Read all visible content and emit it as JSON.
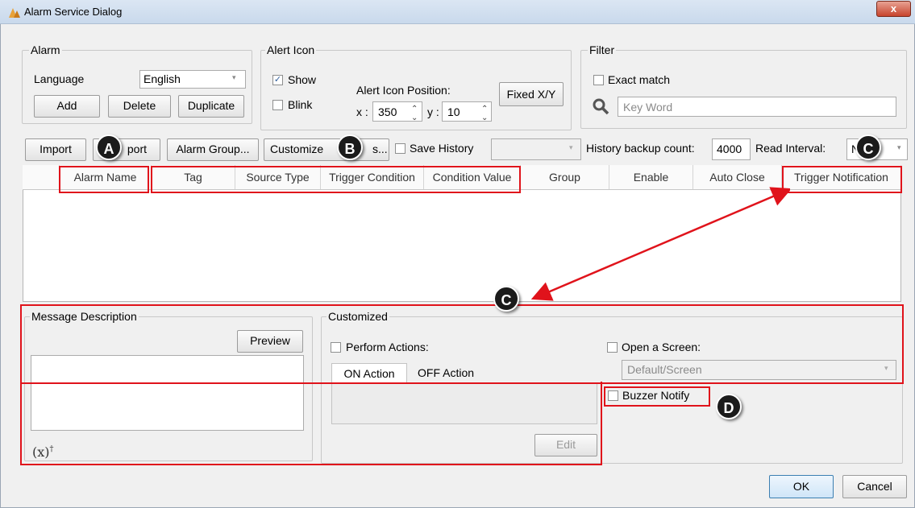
{
  "window": {
    "title": "Alarm Service Dialog",
    "close_symbol": "x"
  },
  "alarm": {
    "legend": "Alarm",
    "language_label": "Language",
    "language_value": "English",
    "add": "Add",
    "delete": "Delete",
    "duplicate": "Duplicate"
  },
  "alert_icon": {
    "legend": "Alert Icon",
    "show": "Show",
    "show_checked": true,
    "blink": "Blink",
    "position_label": "Alert Icon Position:",
    "x_label": "x :",
    "x_value": "350",
    "y_label": "y :",
    "y_value": "10",
    "fixed": "Fixed X/Y"
  },
  "filter": {
    "legend": "Filter",
    "exact_match": "Exact match",
    "keyword_placeholder": "Key Word"
  },
  "toolbar": {
    "import": "Import",
    "export_partial": "port",
    "alarm_group": "Alarm Group...",
    "customize": "Customize",
    "customize_tail": "s...",
    "save_history": "Save History",
    "history_backup_label": "History backup count:",
    "history_backup_value": "4000",
    "read_interval_label": "Read Interval:",
    "read_interval_value": "N"
  },
  "table": {
    "columns": [
      "Alarm Name",
      "Tag",
      "Source Type",
      "Trigger Condition",
      "Condition Value",
      "Group",
      "Enable",
      "Auto Close",
      "Trigger Notification"
    ]
  },
  "message": {
    "legend": "Message Description",
    "preview": "Preview",
    "variable_icon_text": "(x)"
  },
  "customized": {
    "legend": "Customized",
    "perform_actions": "Perform Actions:",
    "on_action": "ON Action",
    "off_action": "OFF Action",
    "edit": "Edit",
    "open_screen": "Open a Screen:",
    "screen_value": "Default/Screen",
    "buzzer": "Buzzer Notify"
  },
  "markers": {
    "a": "A",
    "b": "B",
    "c1": "C",
    "c2": "C",
    "d": "D"
  },
  "footer": {
    "ok": "OK",
    "cancel": "Cancel"
  },
  "colors": {
    "annotation_red": "#e0131b",
    "marker_fill": "#1b1b1b"
  }
}
